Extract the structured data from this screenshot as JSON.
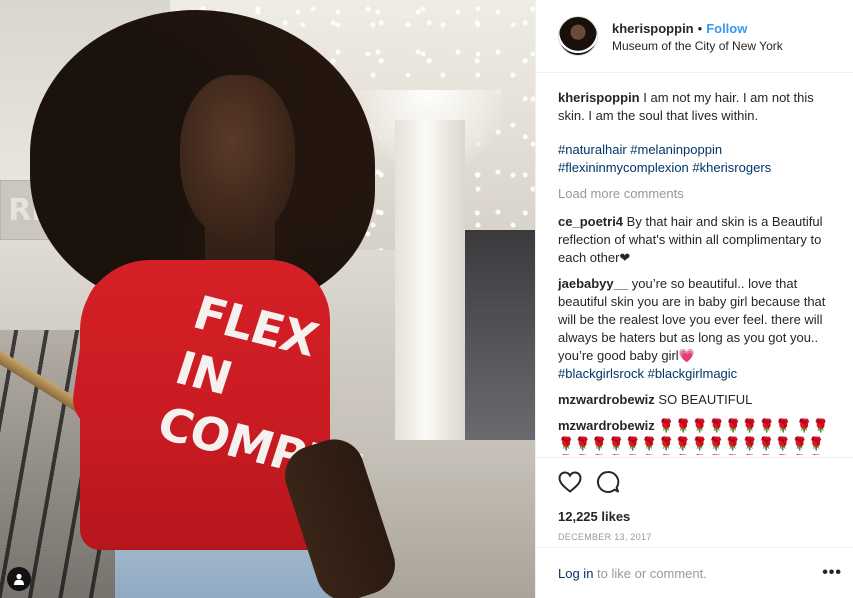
{
  "post": {
    "username": "kherispoppin",
    "follow_label": "Follow",
    "separator": "•",
    "location": "Museum of the City of New York",
    "shirt_text_lines": [
      "FLEX",
      "IN",
      "COMPLE"
    ],
    "wall_sign_text": "RE"
  },
  "caption": {
    "username": "kherispoppin",
    "text": "I am not my hair. I am not this skin. I am the soul that lives within.",
    "hashtags": "#naturalhair #melaninpoppin #flexininmycomplexion #kherisrogers"
  },
  "load_more_label": "Load more comments",
  "comments": [
    {
      "user": "ce_poetri4",
      "text": "By that hair and skin is a Beautiful reflection of what's within all complimentary to each other❤"
    },
    {
      "user": "jaebabyy__",
      "text": "you’re so beautiful.. love that beautiful skin you are in baby girl because that will be the realest love you ever feel. there will always be haters but as long as you got you.. you’re good baby girl💗",
      "tags": "#blackgirlsrock #blackgirlmagic"
    },
    {
      "user": "mzwardrobewiz",
      "text": "SO BEAUTIFUL"
    },
    {
      "user": "mzwardrobewiz",
      "text": "🌹🌹🌹🌹🌹🌹🌹🌹 🌹🌹🌹🌹🌹🌹🌹🌹🌹🌹🌹🌹🌹🌹🌹🌹🌹🌹🌹🌹🌹🌹🌹🌹🌹🌹🌹🌹🌹🌹🌹🌹🌹🌹🌹🌹"
    }
  ],
  "likes_label": "12,225 likes",
  "date": "DECEMBER 13, 2017",
  "login": {
    "link": "Log in",
    "rest": " to like or comment."
  },
  "more_label": "•••",
  "icons": {
    "like": "heart-icon",
    "comment": "comment-bubble-icon",
    "user_tag": "user-tag-icon"
  },
  "colors": {
    "link_blue": "#3897f0",
    "hashtag": "#003569",
    "muted": "#999999",
    "shirt_red": "#d52026"
  }
}
